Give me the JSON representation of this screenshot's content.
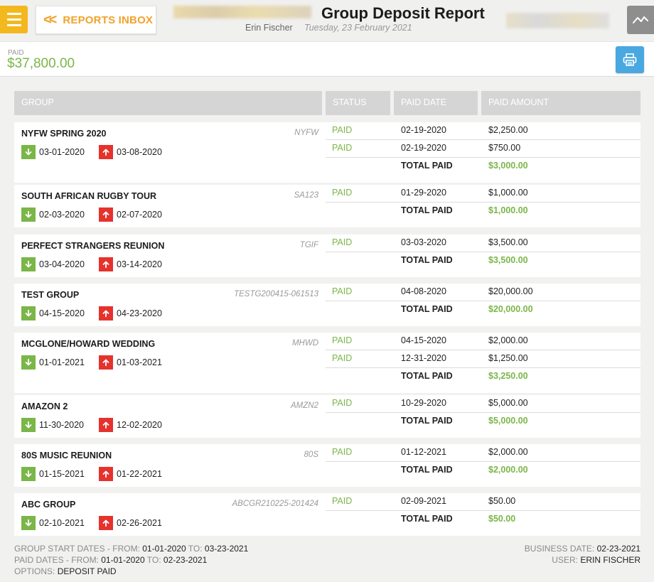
{
  "header": {
    "back_label": "REPORTS INBOX",
    "title": "Group Deposit Report",
    "user": "Erin Fischer",
    "date": "Tuesday, 23 February 2021"
  },
  "summary": {
    "paid_label": "PAID",
    "paid_total": "$37,800.00"
  },
  "columns": {
    "group": "GROUP",
    "status": "STATUS",
    "paid_date": "PAID DATE",
    "paid_amount": "PAID AMOUNT"
  },
  "total_label": "TOTAL PAID",
  "groups": [
    {
      "name": "NYFW SPRING 2020",
      "code": "NYFW",
      "start": "03-01-2020",
      "end": "03-08-2020",
      "payments": [
        {
          "status": "PAID",
          "date": "02-19-2020",
          "amount": "$2,250.00"
        },
        {
          "status": "PAID",
          "date": "02-19-2020",
          "amount": "$750.00"
        }
      ],
      "total": "$3,000.00"
    },
    {
      "name": "SOUTH AFRICAN RUGBY TOUR",
      "code": "SA123",
      "start": "02-03-2020",
      "end": "02-07-2020",
      "payments": [
        {
          "status": "PAID",
          "date": "01-29-2020",
          "amount": "$1,000.00"
        }
      ],
      "total": "$1,000.00"
    },
    {
      "name": "PERFECT STRANGERS REUNION",
      "code": "TGIF",
      "start": "03-04-2020",
      "end": "03-14-2020",
      "payments": [
        {
          "status": "PAID",
          "date": "03-03-2020",
          "amount": "$3,500.00"
        }
      ],
      "total": "$3,500.00"
    },
    {
      "name": "TEST GROUP",
      "code": "TESTG200415-061513",
      "start": "04-15-2020",
      "end": "04-23-2020",
      "payments": [
        {
          "status": "PAID",
          "date": "04-08-2020",
          "amount": "$20,000.00"
        }
      ],
      "total": "$20,000.00"
    },
    {
      "name": "MCGLONE/HOWARD WEDDING",
      "code": "MHWD",
      "start": "01-01-2021",
      "end": "01-03-2021",
      "payments": [
        {
          "status": "PAID",
          "date": "04-15-2020",
          "amount": "$2,000.00"
        },
        {
          "status": "PAID",
          "date": "12-31-2020",
          "amount": "$1,250.00"
        }
      ],
      "total": "$3,250.00"
    },
    {
      "name": "AMAZON 2",
      "code": "AMZN2",
      "start": "11-30-2020",
      "end": "12-02-2020",
      "payments": [
        {
          "status": "PAID",
          "date": "10-29-2020",
          "amount": "$5,000.00"
        }
      ],
      "total": "$5,000.00"
    },
    {
      "name": "80S MUSIC REUNION",
      "code": "80S",
      "start": "01-15-2021",
      "end": "01-22-2021",
      "payments": [
        {
          "status": "PAID",
          "date": "01-12-2021",
          "amount": "$2,000.00"
        }
      ],
      "total": "$2,000.00"
    },
    {
      "name": "ABC GROUP",
      "code": "ABCGR210225-201424",
      "start": "02-10-2021",
      "end": "02-26-2021",
      "payments": [
        {
          "status": "PAID",
          "date": "02-09-2021",
          "amount": "$50.00"
        }
      ],
      "total": "$50.00"
    }
  ],
  "footer": {
    "gsd_label": "GROUP START DATES - FROM:",
    "gsd_from": "01-01-2020",
    "gsd_to_label": "TO:",
    "gsd_to": "03-23-2021",
    "pd_label": "PAID DATES - FROM:",
    "pd_from": "01-01-2020",
    "pd_to_label": "TO:",
    "pd_to": "02-23-2021",
    "opt_label": "OPTIONS:",
    "opt_value": "DEPOSIT PAID",
    "bd_label": "BUSINESS DATE:",
    "bd_value": "02-23-2021",
    "user_label": "USER:",
    "user_value": "ERIN FISCHER"
  },
  "icons": {
    "menu": "hamburger-icon",
    "back": "double-chevron-left-icon",
    "chart": "line-chart-icon",
    "print": "printer-icon",
    "start": "arrow-down-icon",
    "end": "arrow-up-icon"
  },
  "colors": {
    "accent": "#f4b81f",
    "back_text": "#f2a22a",
    "paid_green": "#7ab648",
    "print_blue": "#4aa8e0",
    "start_green": "#7ab648",
    "end_red": "#e5322d"
  }
}
